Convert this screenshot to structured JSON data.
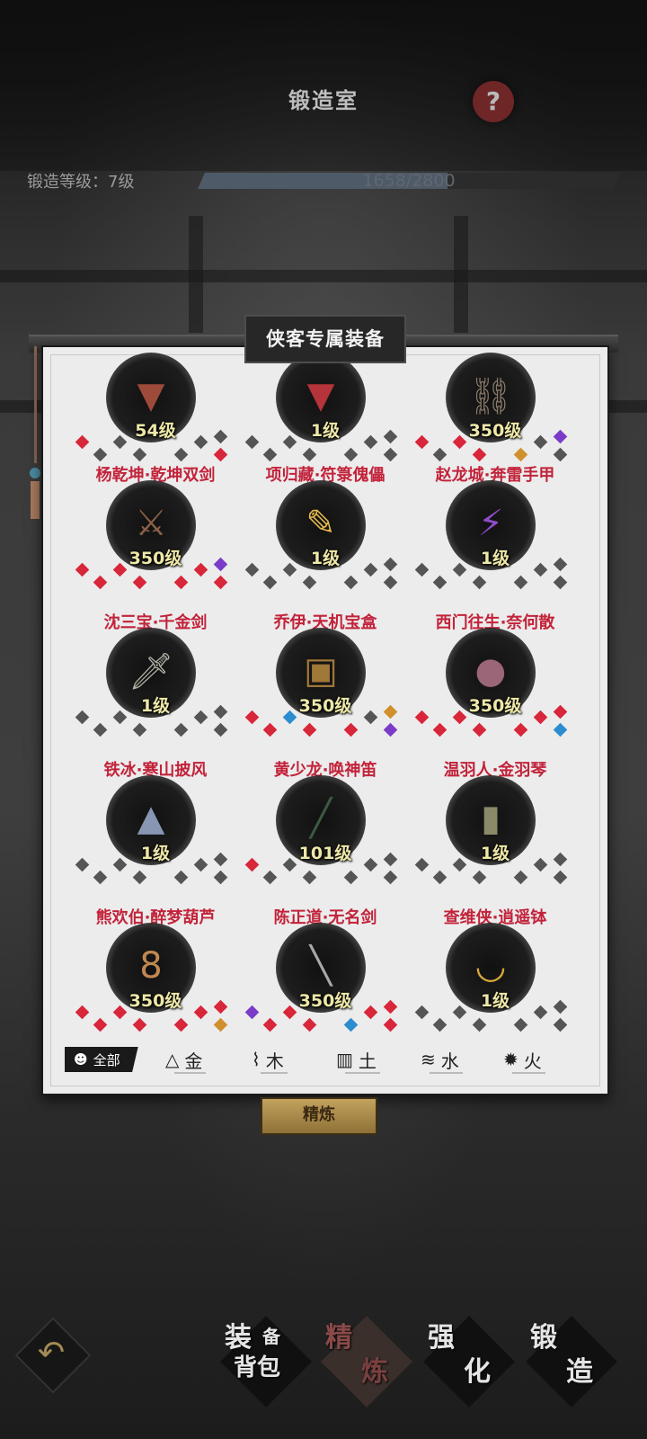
{
  "header": {
    "title": "锻造室",
    "help_icon": "?",
    "level_label": "锻造等级：7级",
    "progress_text": "1658/2800",
    "progress_fraction": 0.592
  },
  "panel": {
    "title": "侠客专属装备",
    "items": [
      {
        "name": "",
        "level": "54级",
        "icon": "armor-icon",
        "color": "#9e4a3a"
      },
      {
        "name": "",
        "level": "1级",
        "icon": "robe-icon",
        "color": "#b4343a"
      },
      {
        "name": "",
        "level": "350级",
        "icon": "chain-whip-icon",
        "color": "#8a7a6a"
      },
      {
        "name": "杨乾坤·乾坤双剑",
        "level": "350级",
        "icon": "twin-swords-icon",
        "color": "#8a6048"
      },
      {
        "name": "项归藏·符箓傀儡",
        "level": "1级",
        "icon": "talisman-icon",
        "color": "#e4b84c"
      },
      {
        "name": "赵龙城·奔雷手甲",
        "level": "1级",
        "icon": "thunder-gauntlet-icon",
        "color": "#8c4cc8"
      },
      {
        "name": "沈三宝·千金剑",
        "level": "1级",
        "icon": "sword-icon",
        "color": "#b4b4a8"
      },
      {
        "name": "乔伊·天机宝盒",
        "level": "350级",
        "icon": "treasure-chest-icon",
        "color": "#a07838"
      },
      {
        "name": "西门往生·奈何散",
        "level": "350级",
        "icon": "pouch-icon",
        "color": "#9a6678"
      },
      {
        "name": "铁冰·寒山披风",
        "level": "1级",
        "icon": "cloak-icon",
        "color": "#8896b4"
      },
      {
        "name": "黄少龙·唤神笛",
        "level": "101级",
        "icon": "flute-icon",
        "color": "#3a5a40"
      },
      {
        "name": "温羽人·金羽琴",
        "level": "1级",
        "icon": "zither-icon",
        "color": "#8a8a6a"
      },
      {
        "name": "熊欢伯·醉梦葫芦",
        "level": "350级",
        "icon": "gourd-icon",
        "color": "#c08850"
      },
      {
        "name": "陈正道·无名剑",
        "level": "350级",
        "icon": "plain-sword-icon",
        "color": "#a8a8a8"
      },
      {
        "name": "查维侠·逍遥钵",
        "level": "1级",
        "icon": "bowl-icon",
        "color": "#d8a838"
      }
    ],
    "filters": [
      {
        "label": "全部",
        "icon": "skull-icon"
      },
      {
        "label": "金",
        "icon": "metal-icon"
      },
      {
        "label": "木",
        "icon": "wood-icon"
      },
      {
        "label": "土",
        "icon": "earth-icon"
      },
      {
        "label": "水",
        "icon": "water-icon"
      },
      {
        "label": "火",
        "icon": "fire-icon"
      }
    ]
  },
  "refine_button": "精炼",
  "bottom_nav": [
    {
      "char1": "装",
      "char2": "背包",
      "small": "备"
    },
    {
      "char1": "精",
      "char2": "炼"
    },
    {
      "char1": "强",
      "char2": "化"
    },
    {
      "char1": "锻",
      "char2": "造"
    }
  ],
  "back_icon": "back-arrow-icon",
  "colors": {
    "gem_red": "#d8263a",
    "gem_gray": "#555555",
    "gem_purple": "#7a3cc8",
    "gem_orange": "#d0902c",
    "gem_blue": "#2c8cd0",
    "name_red": "#c2233a",
    "level_yellow": "#eee8a8"
  }
}
